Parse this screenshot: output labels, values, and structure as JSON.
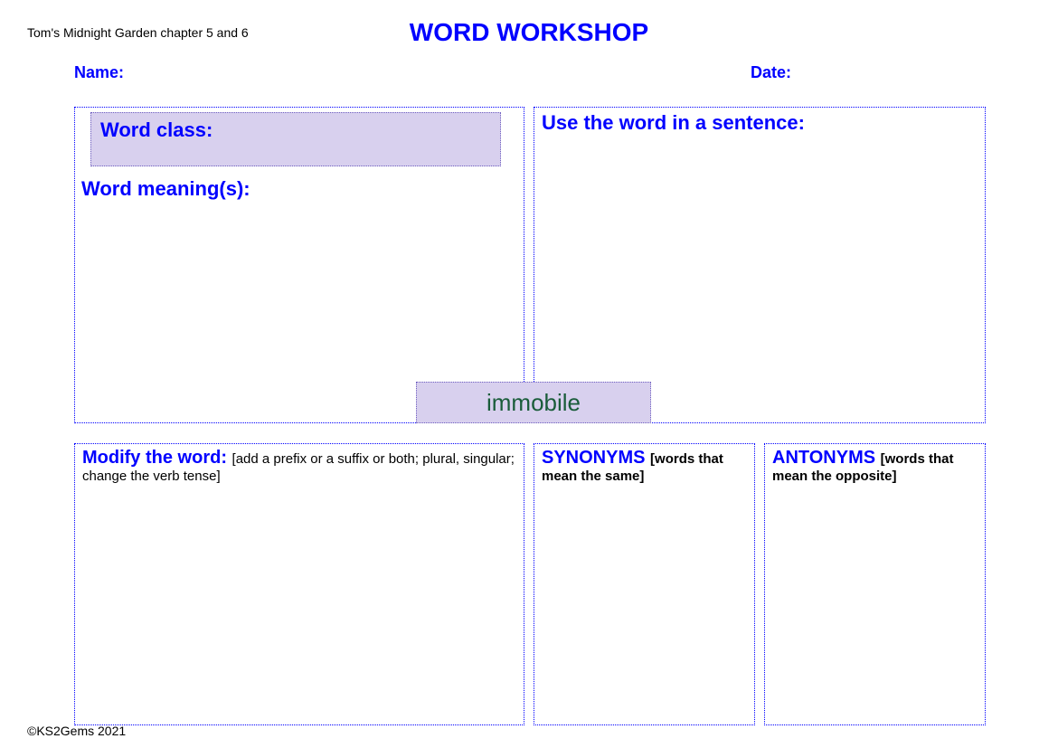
{
  "chapter": "Tom's Midnight Garden chapter 5 and 6",
  "title": "WORD WORKSHOP",
  "name_label": "Name:",
  "date_label": "Date:",
  "word_class_label": "Word class:",
  "word_meanings_label": "Word meaning(s):",
  "sentence_label": "Use the word in a sentence:",
  "center_word": "immobile",
  "modify": {
    "heading": "Modify the word: ",
    "sub": "[add a prefix or a suffix or both; plural, singular; change the verb tense]"
  },
  "synonyms": {
    "heading": "SYNONYMS ",
    "sub": "[words that mean the same]"
  },
  "antonyms": {
    "heading": "ANTONYMS ",
    "sub": "[words that mean the opposite]"
  },
  "copyright": "©KS2Gems 2021"
}
